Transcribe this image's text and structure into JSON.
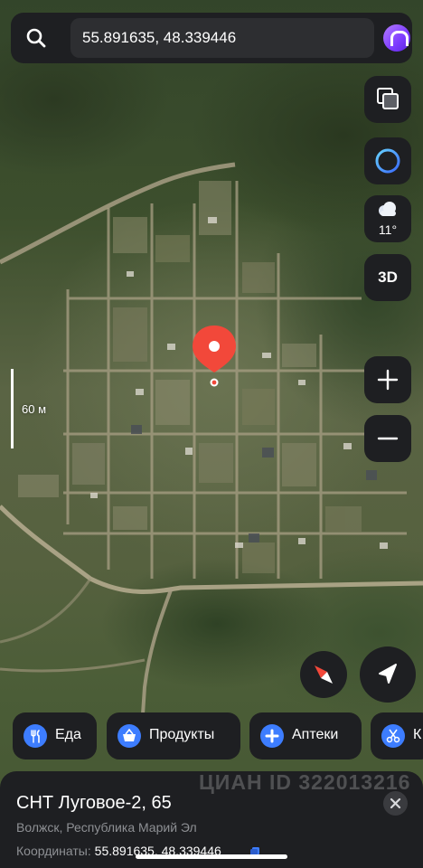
{
  "search": {
    "value": "55.891635, 48.339446"
  },
  "controls": {
    "weather_temp": "11°",
    "mode_3d": "3D"
  },
  "map": {
    "scale_label": "60 м"
  },
  "chips": [
    {
      "label": "Еда",
      "icon": "fork-knife-icon",
      "color": "#3d7dff"
    },
    {
      "label": "Продукты",
      "icon": "basket-icon",
      "color": "#3d7dff"
    },
    {
      "label": "Аптеки",
      "icon": "plus-icon",
      "color": "#3d7dff"
    },
    {
      "label": "К",
      "icon": "scissors-icon",
      "color": "#3d7dff"
    }
  ],
  "watermark": "ЦИАН ID 322013216",
  "card": {
    "title": "СНТ Луговое-2, 65",
    "address": "Волжск, Республика Марий Эл",
    "coords_label": "Координаты:",
    "coords_value": "55.891635, 48.339446"
  },
  "colors": {
    "pin": "#f2483a",
    "panel": "#1e1f22",
    "accent": "#3d7dff"
  }
}
